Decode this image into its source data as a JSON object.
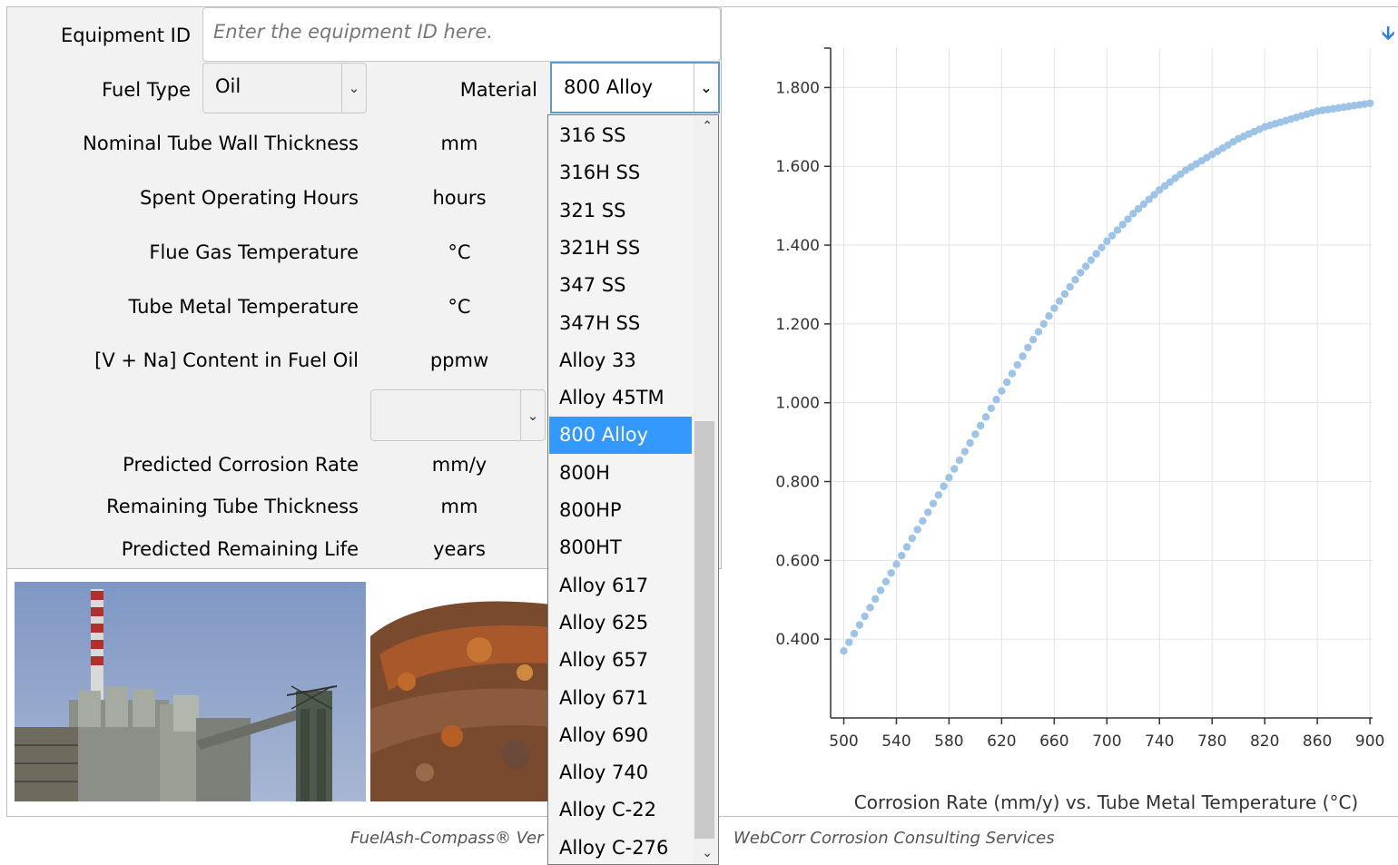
{
  "form": {
    "equipment_id": {
      "label": "Equipment ID",
      "placeholder": "Enter the equipment ID here."
    },
    "fuel_type": {
      "label": "Fuel Type",
      "value": "Oil"
    },
    "material": {
      "label": "Material",
      "value": "800 Alloy"
    },
    "rows": [
      {
        "label": "Nominal Tube Wall Thickness",
        "unit": "mm"
      },
      {
        "label": "Spent Operating Hours",
        "unit": "hours"
      },
      {
        "label": "Flue Gas Temperature",
        "unit": "°C"
      },
      {
        "label": "Tube Metal Temperature",
        "unit": "°C"
      },
      {
        "label": "[V + Na] Content in Fuel Oil",
        "unit": "ppmw"
      }
    ],
    "extra_select": {
      "value": ""
    },
    "results": [
      {
        "label": "Predicted Corrosion Rate",
        "unit": "mm/y"
      },
      {
        "label": "Remaining Tube Thickness",
        "unit": "mm"
      },
      {
        "label": "Predicted Remaining Life",
        "unit": "years"
      }
    ]
  },
  "material_options": [
    "316 SS",
    "316H SS",
    "321 SS",
    "321H SS",
    "347 SS",
    "347H SS",
    "Alloy 33",
    "Alloy 45TM",
    "800 Alloy",
    "800H",
    "800HP",
    "800HT",
    "Alloy 617",
    "Alloy 625",
    "Alloy 657",
    "Alloy 671",
    "Alloy 690",
    "Alloy 740",
    "Alloy C-22",
    "Alloy C-276"
  ],
  "material_selected_index": 8,
  "footer": {
    "left": "FuelAsh-Compass® Ver",
    "right": "WebCorr Corrosion Consulting Services"
  },
  "colors": {
    "accent": "#3399ff",
    "point": "#9dc3e6"
  },
  "chart_data": {
    "type": "scatter",
    "title": "Corrosion Rate (mm/y) vs. Tube Metal Temperature (°C)",
    "xlabel": "",
    "ylabel": "",
    "xlim": [
      490,
      902
    ],
    "ylim": [
      0.2,
      1.9
    ],
    "xticks": [
      500,
      540,
      580,
      620,
      660,
      700,
      740,
      780,
      820,
      860,
      900
    ],
    "xtick_labels": [
      "500",
      "540",
      "580",
      "620",
      "660",
      "700",
      "740",
      "780",
      "820",
      "860",
      "900"
    ],
    "yticks": [
      0.4,
      0.6,
      0.8,
      1.0,
      1.2,
      1.4,
      1.6,
      1.8
    ],
    "ytick_labels": [
      "0.400",
      "0.600",
      "0.800",
      "1.000",
      "1.200",
      "1.400",
      "1.600",
      "1.800"
    ],
    "grid": true,
    "series": [
      {
        "x": [
          500,
          520,
          540,
          560,
          580,
          600,
          620,
          640,
          660,
          680,
          700,
          720,
          740,
          760,
          780,
          800,
          820,
          840,
          860,
          880,
          900
        ],
        "y": [
          0.37,
          0.48,
          0.59,
          0.7,
          0.81,
          0.92,
          1.03,
          1.14,
          1.24,
          1.33,
          1.41,
          1.48,
          1.54,
          1.59,
          1.63,
          1.67,
          1.7,
          1.72,
          1.74,
          1.75,
          1.76
        ]
      }
    ]
  }
}
